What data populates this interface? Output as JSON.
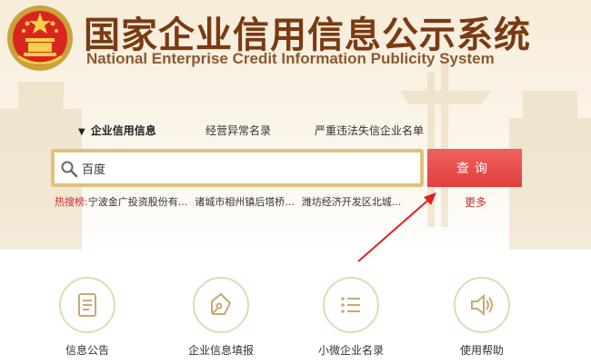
{
  "header": {
    "title_cn": "国家企业信用信息公示系统",
    "title_en": "National Enterprise Credit Information Publicity System"
  },
  "tabs": [
    {
      "label": "企业信用信息",
      "active": true
    },
    {
      "label": "经营异常名录",
      "active": false
    },
    {
      "label": "严重违法失信企业名单",
      "active": false
    }
  ],
  "search": {
    "value": "百度",
    "button_label": "查询"
  },
  "hot": {
    "label": "热搜榜:",
    "items": [
      "宁波金广投资股份有...",
      "诸城市相州镇后塔桥...",
      "潍坊经济开发区北城..."
    ],
    "more_label": "更多"
  },
  "functions": [
    {
      "label": "信息公告",
      "icon": "document-icon"
    },
    {
      "label": "企业信息填报",
      "icon": "pen-nib-icon"
    },
    {
      "label": "小微企业名录",
      "icon": "list-icon"
    },
    {
      "label": "使用帮助",
      "icon": "speaker-icon"
    }
  ],
  "colors": {
    "title": "#7a3a12",
    "accent_red": "#e0403e",
    "search_border": "#e0c27c",
    "hot_red": "#d12a2a"
  }
}
